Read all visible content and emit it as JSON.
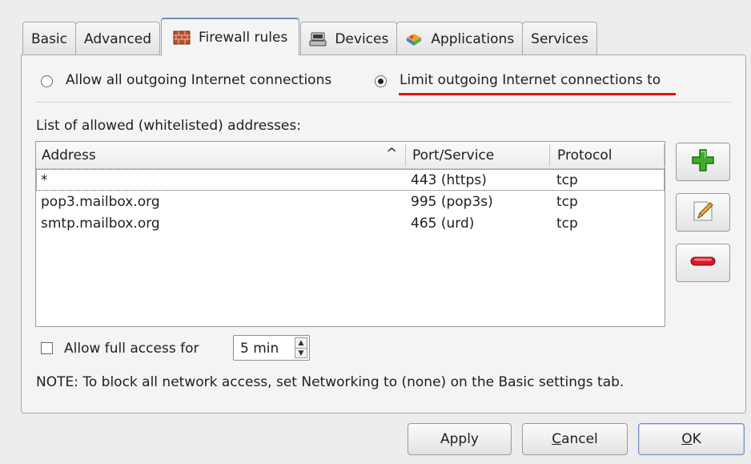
{
  "tabs": [
    {
      "label": "Basic"
    },
    {
      "label": "Advanced"
    },
    {
      "label": "Firewall rules",
      "icon": "firewall-icon"
    },
    {
      "label": "Devices",
      "icon": "devices-icon"
    },
    {
      "label": "Applications",
      "icon": "applications-icon"
    },
    {
      "label": "Services"
    }
  ],
  "policy": {
    "allow_all_label": "Allow all outgoing Internet connections",
    "limit_label": "Limit outgoing Internet connections to",
    "selected": "limit",
    "highlight_color": "#e01010"
  },
  "whitelist": {
    "title": "List of allowed (whitelisted) addresses:",
    "columns": [
      "Address",
      "Port/Service",
      "Protocol"
    ],
    "sort_indicator": "^",
    "rows": [
      {
        "address": "*",
        "port": "443 (https)",
        "protocol": "tcp"
      },
      {
        "address": "pop3.mailbox.org",
        "port": "995 (pop3s)",
        "protocol": "tcp"
      },
      {
        "address": "smtp.mailbox.org",
        "port": "465 (urd)",
        "protocol": "tcp"
      }
    ],
    "side_buttons": [
      "plus-icon",
      "edit-pencil-icon",
      "minus-icon"
    ]
  },
  "full_access": {
    "label": "Allow full access for",
    "checked": false,
    "value": "5 min"
  },
  "note": "NOTE:  To block all network access, set Networking to (none) on the Basic settings tab.",
  "buttons": {
    "apply": "Apply",
    "cancel_mnemonic": "C",
    "cancel_rest": "ancel",
    "ok_mnemonic": "O",
    "ok_rest": "K"
  }
}
